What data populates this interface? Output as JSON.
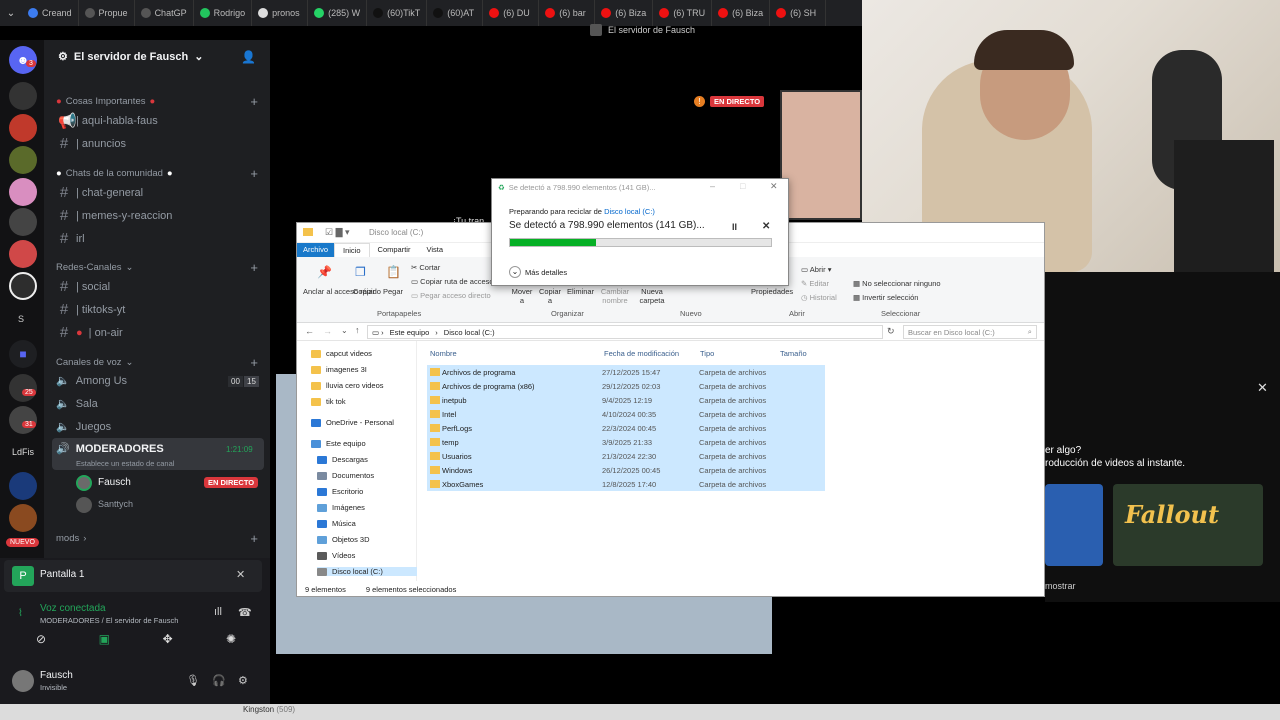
{
  "browser_tabs": [
    {
      "label": "Creand",
      "color": "#3c7cf0"
    },
    {
      "label": "Propue",
      "color": "#555"
    },
    {
      "label": "ChatGP",
      "color": "#555"
    },
    {
      "label": "Rodrigo",
      "color": "#22c55e"
    },
    {
      "label": "pronos",
      "color": "#ddd"
    },
    {
      "label": "(285) W",
      "color": "#25d366"
    },
    {
      "label": "(60)TikT",
      "color": "#111"
    },
    {
      "label": "(60)AT",
      "color": "#111"
    },
    {
      "label": "(6) DU",
      "color": "#e11"
    },
    {
      "label": "(6) bar",
      "color": "#e11"
    },
    {
      "label": "(6) Biza",
      "color": "#e11"
    },
    {
      "label": "(6) TRU",
      "color": "#e11"
    },
    {
      "label": "(6) Biza",
      "color": "#e11"
    },
    {
      "label": "(6) SH",
      "color": "#e11"
    }
  ],
  "stream_title": "El servidor de Fausch",
  "rail_badges": {
    "top": "3",
    "a": "1",
    "b": "25",
    "c": "31",
    "nuevo": "NUEVO",
    "ldfis": "LdFis",
    "s": "S"
  },
  "server": {
    "name": "El servidor de Fausch",
    "cat1": "Cosas Importantes",
    "ch_aqui": "| aqui-habla-faus",
    "ch_anuncios": "| anuncios",
    "cat2": "Chats de la comunidad",
    "ch_general": "| chat-general",
    "ch_memes": "| memes-y-reaccion",
    "ch_irl": "irl",
    "cat3": "Redes-Canales",
    "ch_social": "| social",
    "ch_tiktoks": "| tiktoks-yt",
    "ch_onair": "| on-air",
    "cat4": "Canales de voz",
    "v_among": "Among Us",
    "v_among_a": "00",
    "v_among_b": "15",
    "v_sala": "Sala",
    "v_juegos": "Juegos",
    "v_mods": "MODERADORES",
    "v_mods_time": "1:21:09",
    "v_mods_status": "Establece un estado de canal",
    "u_fausch": "Fausch",
    "live": "EN DIRECTO",
    "u_santty": "Santtych",
    "cat5": "mods"
  },
  "panel": {
    "screen": "Pantalla 1",
    "voice": "Voz conectada",
    "voice_sub": "MODERADORES / El servidor de Fausch",
    "user": "Fausch",
    "user_status": "Invisible"
  },
  "stage_live": "EN DIRECTO",
  "stage_text": "¡Tu tran",
  "right": {
    "q1": "er algo?",
    "q2": "roducción de videos al instante.",
    "fallout": "Fallout",
    "mostrar": "mostrar",
    "kingston": "Kingston",
    "kingston_n": "(509)"
  },
  "explorer": {
    "title": "Disco local (C:)",
    "tabs": [
      "Archivo",
      "Inicio",
      "Compartir",
      "Vista"
    ],
    "ribbon": {
      "anclar": "Anclar al acceso rápido",
      "copiar": "Copiar",
      "pegar": "Pegar",
      "cortar": "Cortar",
      "copiar_ruta": "Copiar ruta de acceso",
      "pegar_acceso": "Pegar acceso directo",
      "mover": "Mover a",
      "copiar_a": "Copiar a",
      "eliminar": "Eliminar",
      "cambiar": "Cambiar nombre",
      "nueva": "Nueva carpeta",
      "propiedades": "Propiedades",
      "abrir": "Abrir",
      "editar": "Editar",
      "historial": "Historial",
      "no_sel": "No seleccionar ninguno",
      "invertir": "Invertir selección",
      "g_porta": "Portapapeles",
      "g_org": "Organizar",
      "g_nuevo": "Nuevo",
      "g_abrir": "Abrir",
      "g_sel": "Seleccionar"
    },
    "address": [
      "Este equipo",
      "Disco local (C:)"
    ],
    "search_placeholder": "Buscar en Disco local (C:)",
    "nav": [
      "capcut videos",
      "imagenes 3I",
      "lluvia cero videos",
      "tik tok",
      "OneDrive - Personal",
      "Este equipo",
      "Descargas",
      "Documentos",
      "Escritorio",
      "Imágenes",
      "Música",
      "Objetos 3D",
      "Vídeos",
      "Disco local (C:)"
    ],
    "columns": [
      "Nombre",
      "Fecha de modificación",
      "Tipo",
      "Tamaño"
    ],
    "files": [
      {
        "name": "Archivos de programa",
        "date": "27/12/2025 15:47",
        "type": "Carpeta de archivos"
      },
      {
        "name": "Archivos de programa (x86)",
        "date": "29/12/2025 02:03",
        "type": "Carpeta de archivos"
      },
      {
        "name": "inetpub",
        "date": "9/4/2025 12:19",
        "type": "Carpeta de archivos"
      },
      {
        "name": "Intel",
        "date": "4/10/2024 00:35",
        "type": "Carpeta de archivos"
      },
      {
        "name": "PerfLogs",
        "date": "22/3/2024 00:45",
        "type": "Carpeta de archivos"
      },
      {
        "name": "temp",
        "date": "3/9/2025 21:33",
        "type": "Carpeta de archivos"
      },
      {
        "name": "Usuarios",
        "date": "21/3/2024 22:30",
        "type": "Carpeta de archivos"
      },
      {
        "name": "Windows",
        "date": "26/12/2025 00:45",
        "type": "Carpeta de archivos"
      },
      {
        "name": "XboxGames",
        "date": "12/8/2025 17:40",
        "type": "Carpeta de archivos"
      }
    ],
    "status_count": "9 elementos",
    "status_sel": "9 elementos seleccionados"
  },
  "dialog": {
    "title": "Se detectó a 798.990 elementos (141 GB)...",
    "prep": "Preparando para reciclar de",
    "prep_link": "Disco local (C:)",
    "main": "Se detectó a 798.990 elementos (141 GB)...",
    "progress": 0.33,
    "more": "Más detalles"
  }
}
